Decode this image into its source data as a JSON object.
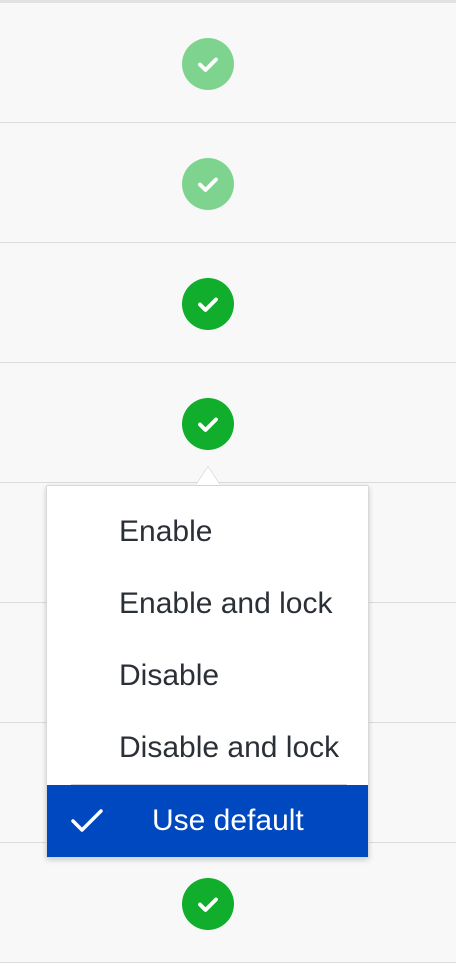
{
  "rows": [
    {
      "status": "enabled-default",
      "icon": "check-circle-icon",
      "color": "#7ed48f"
    },
    {
      "status": "enabled-default",
      "icon": "check-circle-icon",
      "color": "#7ed48f"
    },
    {
      "status": "enabled",
      "icon": "check-circle-icon",
      "color": "#11ad2c"
    },
    {
      "status": "enabled",
      "icon": "check-circle-icon",
      "color": "#11ad2c"
    },
    {
      "status": "hidden-by-menu",
      "icon": "",
      "color": ""
    },
    {
      "status": "hidden-by-menu",
      "icon": "",
      "color": ""
    },
    {
      "status": "hidden-by-menu",
      "icon": "",
      "color": ""
    },
    {
      "status": "enabled",
      "icon": "check-circle-icon",
      "color": "#11ad2c"
    }
  ],
  "menu": {
    "items": [
      {
        "label": "Enable"
      },
      {
        "label": "Enable and lock"
      },
      {
        "label": "Disable"
      },
      {
        "label": "Disable and lock"
      }
    ],
    "selected": {
      "label": "Use default",
      "icon": "check-icon"
    },
    "selected_color": "#0048c0"
  }
}
